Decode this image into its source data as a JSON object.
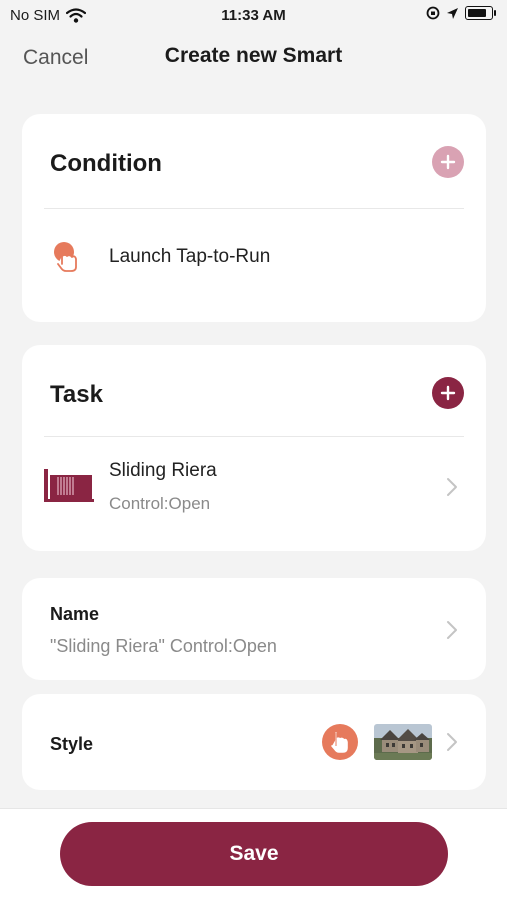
{
  "status_bar": {
    "carrier": "No SIM",
    "time": "11:33 AM"
  },
  "nav": {
    "cancel_label": "Cancel",
    "title": "Create new Smart"
  },
  "condition": {
    "title": "Condition",
    "add_icon": "plus-icon",
    "add_color": "#d9a2b3",
    "item": {
      "icon": "tap-hand-icon",
      "label": "Launch Tap-to-Run"
    }
  },
  "task": {
    "title": "Task",
    "add_icon": "plus-icon",
    "add_color": "#8a2543",
    "item": {
      "icon": "sliding-gate-icon",
      "label": "Sliding Riera",
      "detail": "Control:Open"
    }
  },
  "name": {
    "title": "Name",
    "value": "\"Sliding Riera\" Control:Open"
  },
  "style": {
    "title": "Style",
    "icon": "tap-hand-icon",
    "thumbnail": "house-photo"
  },
  "save_label": "Save",
  "colors": {
    "accent": "#8a2543",
    "icon_orange": "#e67a5c"
  }
}
